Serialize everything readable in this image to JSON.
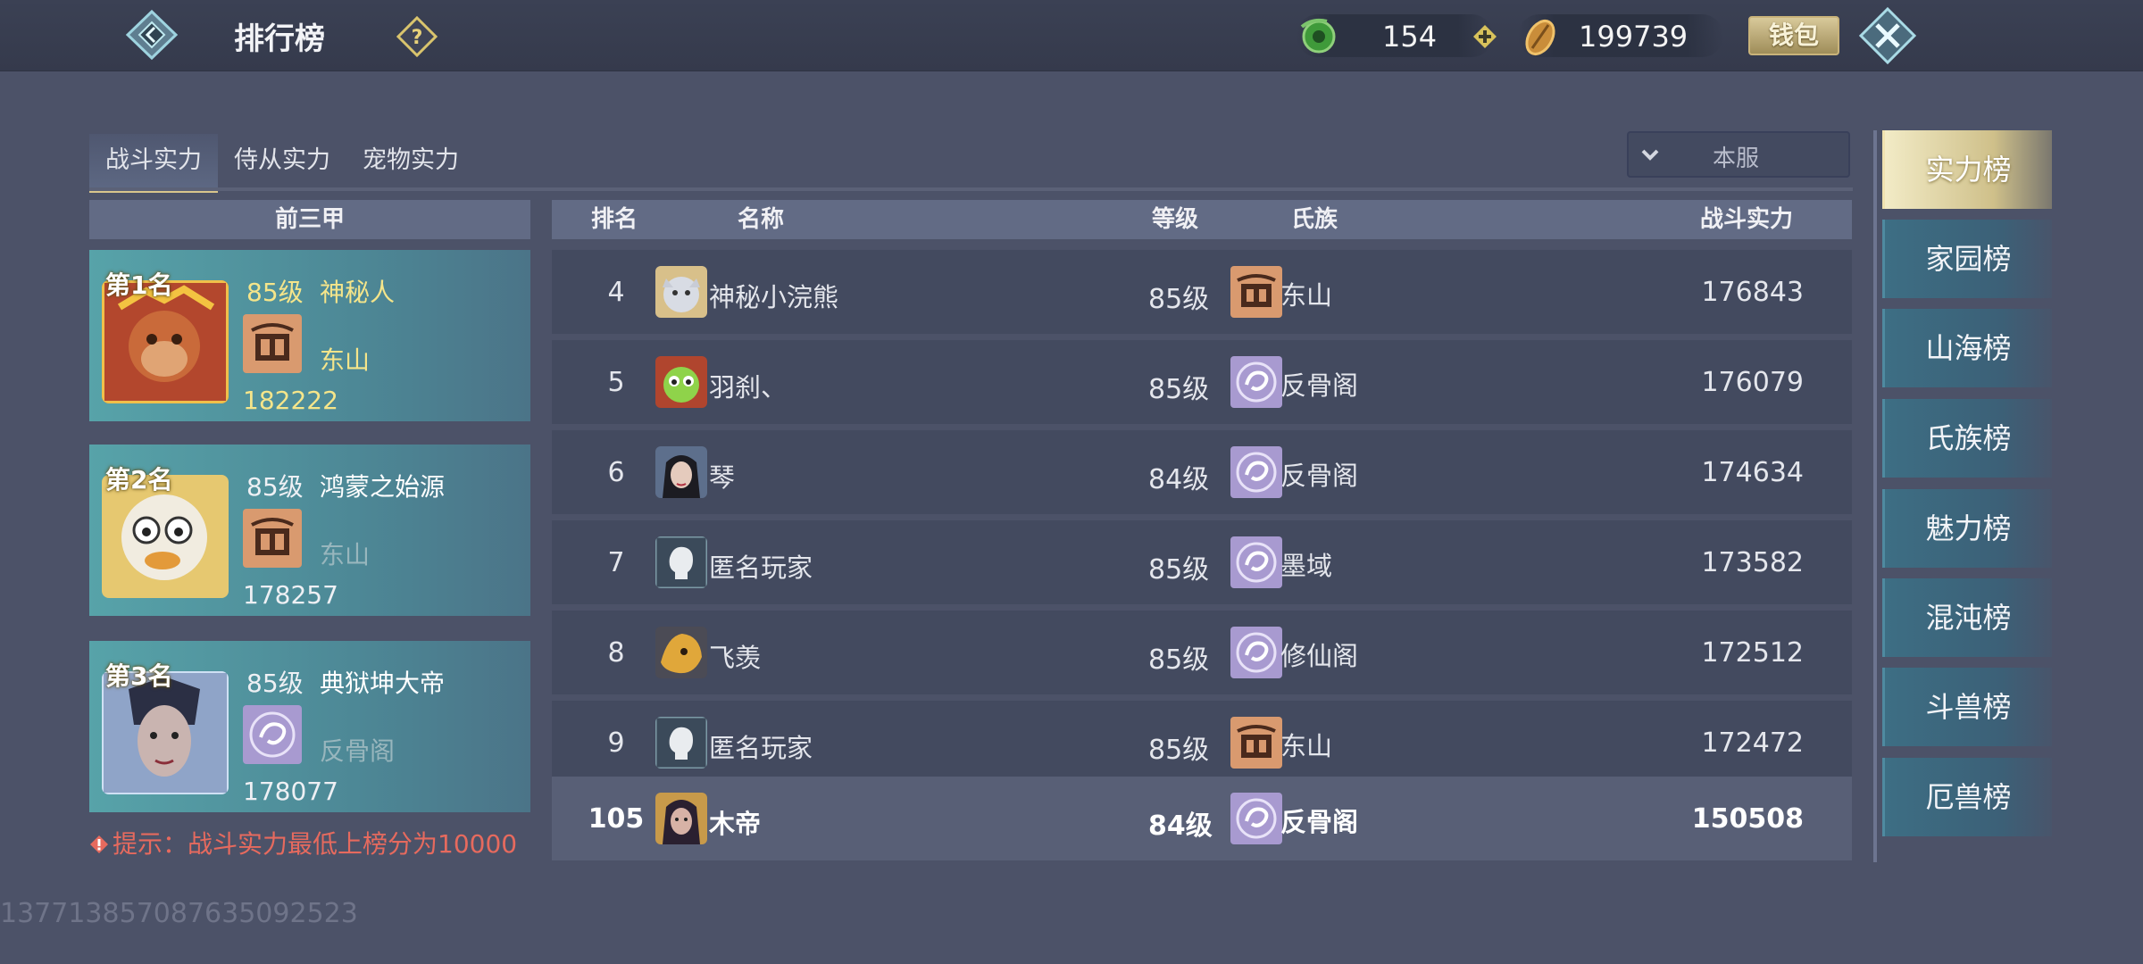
{
  "header": {
    "title": "排行榜",
    "jade_amount": "154",
    "coin_amount": "199739",
    "wallet_label": "钱包"
  },
  "tabs": [
    {
      "label": "战斗实力",
      "active": true
    },
    {
      "label": "侍从实力",
      "active": false
    },
    {
      "label": "宠物实力",
      "active": false
    }
  ],
  "server_select": {
    "value": "本服"
  },
  "top3": {
    "header": "前三甲",
    "cards": [
      {
        "rank": "第1名",
        "level": "85级",
        "name": "神秘人",
        "clan": "东山",
        "score": "182222"
      },
      {
        "rank": "第2名",
        "level": "85级",
        "name": "鸿蒙之始源",
        "clan": "东山",
        "score": "178257"
      },
      {
        "rank": "第3名",
        "level": "85级",
        "name": "典狱坤大帝",
        "clan": "反骨阁",
        "score": "178077"
      }
    ]
  },
  "tip": "提示：战斗实力最低上榜分为10000",
  "table": {
    "headers": {
      "rank": "排名",
      "name": "名称",
      "level": "等级",
      "clan": "氏族",
      "score": "战斗实力"
    },
    "rows": [
      {
        "rank": "4",
        "name": "神秘小浣熊",
        "level": "85级",
        "clan": "东山",
        "score": "176843"
      },
      {
        "rank": "5",
        "name": "羽刹、",
        "level": "85级",
        "clan": "反骨阁",
        "score": "176079"
      },
      {
        "rank": "6",
        "name": "琴",
        "level": "84级",
        "clan": "反骨阁",
        "score": "174634"
      },
      {
        "rank": "7",
        "name": "匿名玩家",
        "level": "85级",
        "clan": "墨域",
        "score": "173582"
      },
      {
        "rank": "8",
        "name": "飞羡",
        "level": "85级",
        "clan": "修仙阁",
        "score": "172512"
      },
      {
        "rank": "9",
        "name": "匿名玩家",
        "level": "85级",
        "clan": "东山",
        "score": "172472"
      }
    ],
    "self_row": {
      "rank": "105",
      "name": "木帝",
      "level": "84级",
      "clan": "反骨阁",
      "score": "150508"
    }
  },
  "side_menu": [
    {
      "label": "实力榜",
      "active": true
    },
    {
      "label": "家园榜",
      "active": false
    },
    {
      "label": "山海榜",
      "active": false
    },
    {
      "label": "氏族榜",
      "active": false
    },
    {
      "label": "魅力榜",
      "active": false
    },
    {
      "label": "混沌榜",
      "active": false
    },
    {
      "label": "斗兽榜",
      "active": false
    },
    {
      "label": "厄兽榜",
      "active": false
    }
  ],
  "footer_id": "13771385708763509​2523"
}
